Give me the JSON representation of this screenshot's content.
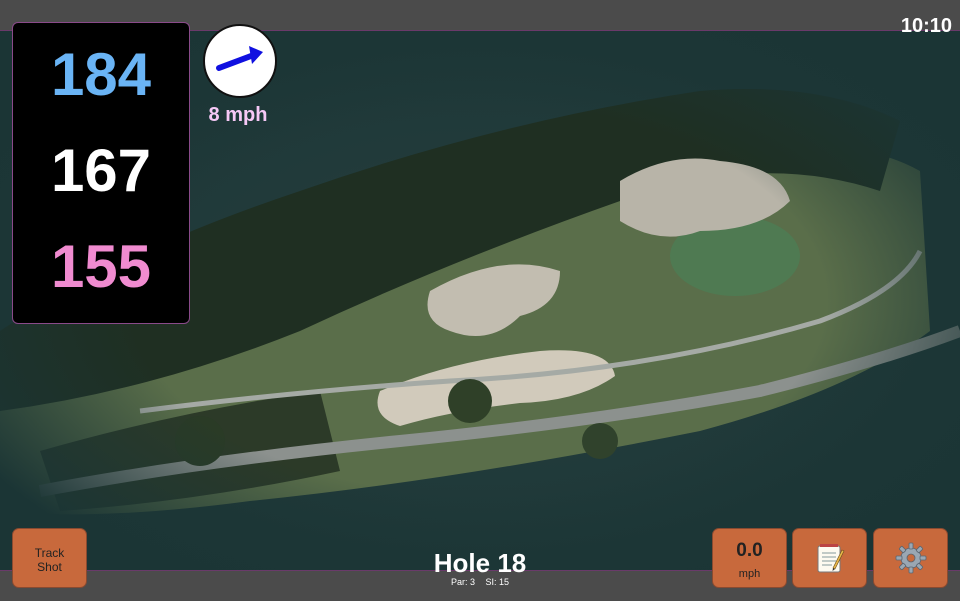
{
  "header": {
    "clock": "10:10"
  },
  "distances": {
    "back": "184",
    "middle": "167",
    "front": "155"
  },
  "wind": {
    "speed": "8 mph",
    "icon": "wind-arrow-icon",
    "arrow_color": "#1010e0"
  },
  "buttons": {
    "track_shot": [
      "Track",
      "Shot"
    ],
    "speed": {
      "value": "0.0",
      "unit": "mph"
    },
    "notes_icon": "notepad-icon",
    "settings_icon": "gear-icon"
  },
  "hole": {
    "title": "Hole 18",
    "par": "Par: 3",
    "si": "SI: 15"
  },
  "colors": {
    "button": "#c8693c",
    "back": "#6ab4f5",
    "middle": "#ffffff",
    "front": "#f08bd0"
  }
}
